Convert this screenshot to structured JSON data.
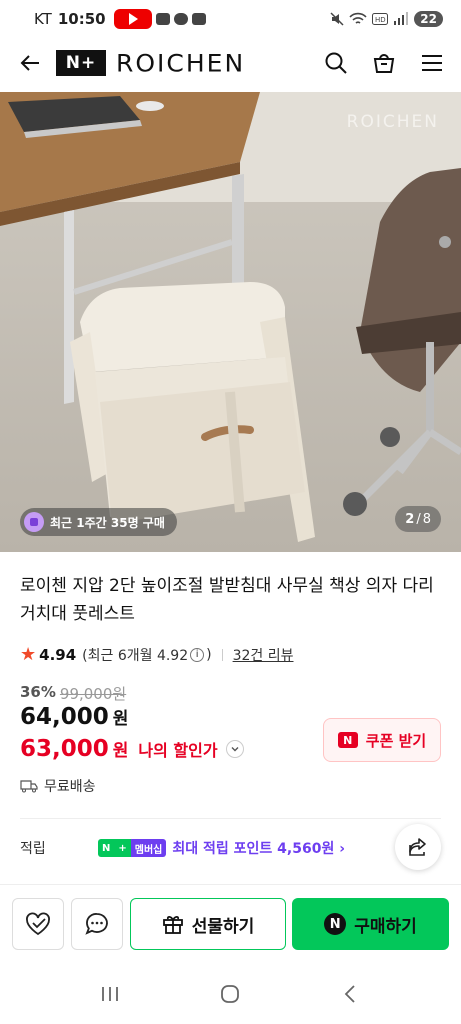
{
  "status_bar": {
    "carrier": "KT",
    "time": "10:50",
    "battery": "22"
  },
  "header": {
    "brand_logo_text": "N+",
    "brand_name": "ROICHEN"
  },
  "gallery": {
    "watermark": "ROICHEN",
    "recent_purchase": "최근 1주간 35명 구매",
    "current_page": "2",
    "page_separator": "/",
    "total_pages": "8"
  },
  "product": {
    "title": "로이첸 지압 2단 높이조절 발받침대 사무실 책상 의자 다리거치대 풋레스트",
    "rating": "4.94",
    "recent_rating_prefix": "(최근 6개월 4.92",
    "recent_rating_suffix": ")",
    "reviews": "32건 리뷰",
    "discount_rate": "36%",
    "original_price": "99,000원",
    "price": "64,000",
    "price_unit": "원",
    "my_price": "63,000",
    "my_price_unit": "원",
    "my_price_label": "나의 할인가",
    "coupon_label": "쿠폰 받기",
    "shipping": "무료배송"
  },
  "points": {
    "label": "적립",
    "badge_n": "N",
    "badge_plus": "+",
    "badge_member": "멤버십",
    "text": "최대 적립 포인트 4,560원 ›"
  },
  "actions": {
    "gift_label": "선물하기",
    "buy_label": "구매하기",
    "buy_icon_text": "N"
  },
  "colors": {
    "accent_green": "#03c75a",
    "price_red": "#e60023",
    "membership_purple": "#6d3ef0"
  }
}
